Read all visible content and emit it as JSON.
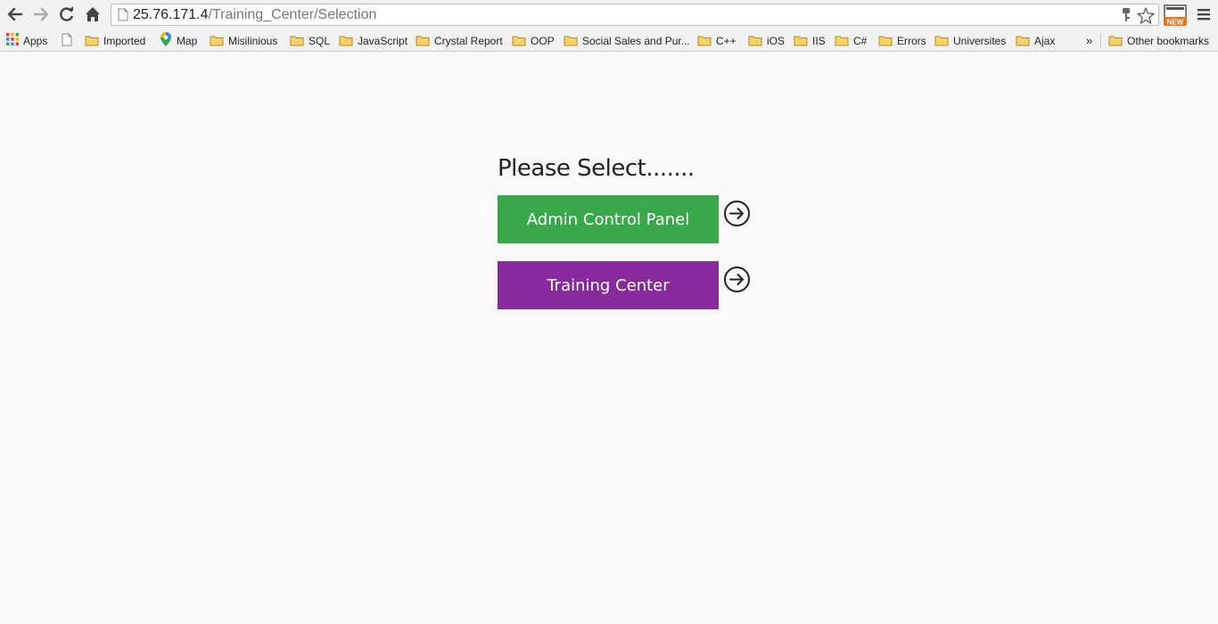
{
  "browser": {
    "url_host": "25.76.171.4",
    "url_path": "/Training_Center/Selection",
    "icons": {
      "back": "back-arrow-icon",
      "forward": "forward-arrow-icon",
      "reload": "reload-icon",
      "home": "home-icon",
      "page": "page-icon",
      "bookmark_star": "star-icon",
      "extension": "new-extension-icon",
      "menu": "hamburger-menu-icon"
    },
    "extension_badge": "NEW"
  },
  "bookmarks": {
    "apps_label": "Apps",
    "items": [
      {
        "label": "Imported",
        "icon": "folder-icon"
      },
      {
        "label": "Map",
        "icon": "maps-icon"
      },
      {
        "label": "Misilinious",
        "icon": "folder-icon"
      },
      {
        "label": "SQL",
        "icon": "folder-icon"
      },
      {
        "label": "JavaScript",
        "icon": "folder-icon"
      },
      {
        "label": "Crystal Report",
        "icon": "folder-icon"
      },
      {
        "label": "OOP",
        "icon": "folder-icon"
      },
      {
        "label": "Social Sales and Pur...",
        "icon": "folder-icon"
      },
      {
        "label": "C++",
        "icon": "folder-icon"
      },
      {
        "label": "iOS",
        "icon": "folder-icon"
      },
      {
        "label": "IIS",
        "icon": "folder-icon"
      },
      {
        "label": "C#",
        "icon": "folder-icon"
      },
      {
        "label": "Errors",
        "icon": "folder-icon"
      },
      {
        "label": "Universites",
        "icon": "folder-icon"
      },
      {
        "label": "Ajax",
        "icon": "folder-icon"
      }
    ],
    "overflow_label": "»",
    "other_label": "Other bookmarks"
  },
  "page": {
    "heading": "Please Select.......",
    "options": [
      {
        "label": "Admin Control Panel",
        "color": "#38a84a"
      },
      {
        "label": "Training Center",
        "color": "#872b9c"
      }
    ]
  },
  "colors": {
    "admin_tile": "#38a84a",
    "training_tile": "#872b9c",
    "background": "#f9f9f9"
  }
}
